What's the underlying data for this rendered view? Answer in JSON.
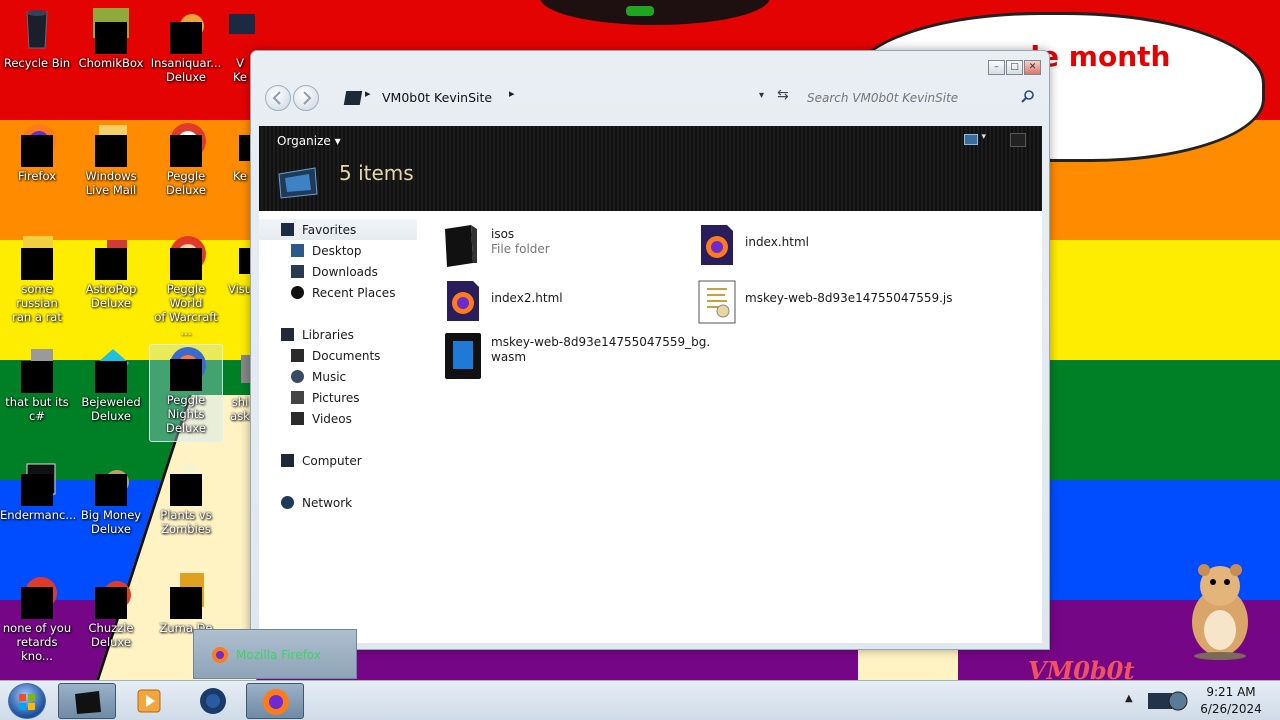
{
  "desktop": {
    "banner_text": "de month",
    "watermark": "VM0b0t",
    "icons": [
      {
        "label": "Recycle Bin"
      },
      {
        "label": "ChomikBox"
      },
      {
        "label": "Insaniquar...\nDeluxe"
      },
      {
        "label": "V\nKe"
      },
      {
        "label": "Firefox"
      },
      {
        "label": "Windows\nLive Mail"
      },
      {
        "label": "Peggle\nDeluxe"
      },
      {
        "label": "Ke"
      },
      {
        "label": "some russian\nran a rat"
      },
      {
        "label": "AstroPop\nDeluxe"
      },
      {
        "label": "Peggle World\nof Warcraft ..."
      },
      {
        "label": "Visu"
      },
      {
        "label": "that but its\nc#"
      },
      {
        "label": "Bejeweled\nDeluxe"
      },
      {
        "label": "Peggle\nNights\nDeluxe"
      },
      {
        "label": "shi\nask"
      },
      {
        "label": "Endermanc..."
      },
      {
        "label": "Big Money\nDeluxe"
      },
      {
        "label": "Plants vs\nZombies"
      },
      {
        "label": "none of you\nretards kno..."
      },
      {
        "label": "Chuzzle\nDeluxe"
      },
      {
        "label": "Zuma De"
      }
    ]
  },
  "explorer": {
    "window_controls": {
      "minimize": "–",
      "maximize": "□",
      "close": "✕"
    },
    "address": {
      "sep": "▸",
      "path": "VM0b0t KevinSite",
      "drop": "▾",
      "refresh": "⇆"
    },
    "search": {
      "placeholder": "Search VM0b0t KevinSite"
    },
    "toolbar": {
      "organize": "Organize ▾",
      "view_arrow": "▾"
    },
    "header": {
      "item_count": "5 items"
    },
    "nav_pane": {
      "favorites": "Favorites",
      "desktop": "Desktop",
      "downloads": "Downloads",
      "recent_places": "Recent Places",
      "libraries": "Libraries",
      "documents": "Documents",
      "music": "Music",
      "pictures": "Pictures",
      "videos": "Videos",
      "computer": "Computer",
      "network": "Network"
    },
    "files": [
      {
        "name": "isos",
        "type": "File folder",
        "icon": "folder-icon"
      },
      {
        "name": "index.html",
        "type": "",
        "icon": "firefox-html-icon"
      },
      {
        "name": "index2.html",
        "type": "",
        "icon": "firefox-html-icon"
      },
      {
        "name": "mskey-web-8d93e14755047559.js",
        "type": "",
        "icon": "script-icon"
      },
      {
        "name": "mskey-web-8d93e14755047559_bg.\nwasm",
        "type": "",
        "icon": "wasm-file-icon"
      }
    ]
  },
  "popup": {
    "text": "Mozilla Firefox"
  },
  "taskbar": {
    "clock_time": "9:21 AM",
    "clock_date": "6/26/2024",
    "tray_arrow": "▲"
  },
  "colors": {
    "accent": "#3a6c9c",
    "toolbar_bg": "#151515",
    "item_count": "#e5d7a8",
    "popup_text": "#3ad65d"
  }
}
